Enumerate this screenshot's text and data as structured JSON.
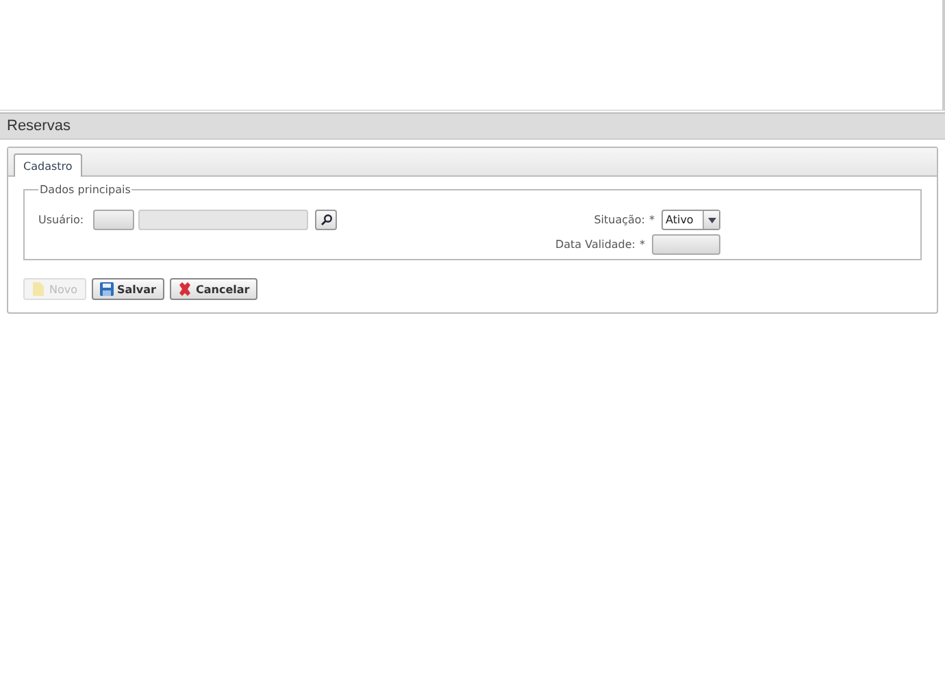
{
  "page_title": "Reservas",
  "tabs": [
    {
      "label": "Cadastro",
      "selected": true
    }
  ],
  "fieldset": {
    "legend": "Dados principais",
    "usuario": {
      "label": "Usuário:"
    },
    "situacao": {
      "label": "Situação:",
      "required": "*",
      "value": "Ativo"
    },
    "data_validade": {
      "label": "Data Validade:",
      "required": "*"
    }
  },
  "buttons": [
    {
      "label": "Novo",
      "kind": "new",
      "disabled": true
    },
    {
      "label": "Salvar",
      "kind": "save",
      "disabled": false
    },
    {
      "label": "Cancelar",
      "kind": "cancel",
      "disabled": false
    }
  ]
}
